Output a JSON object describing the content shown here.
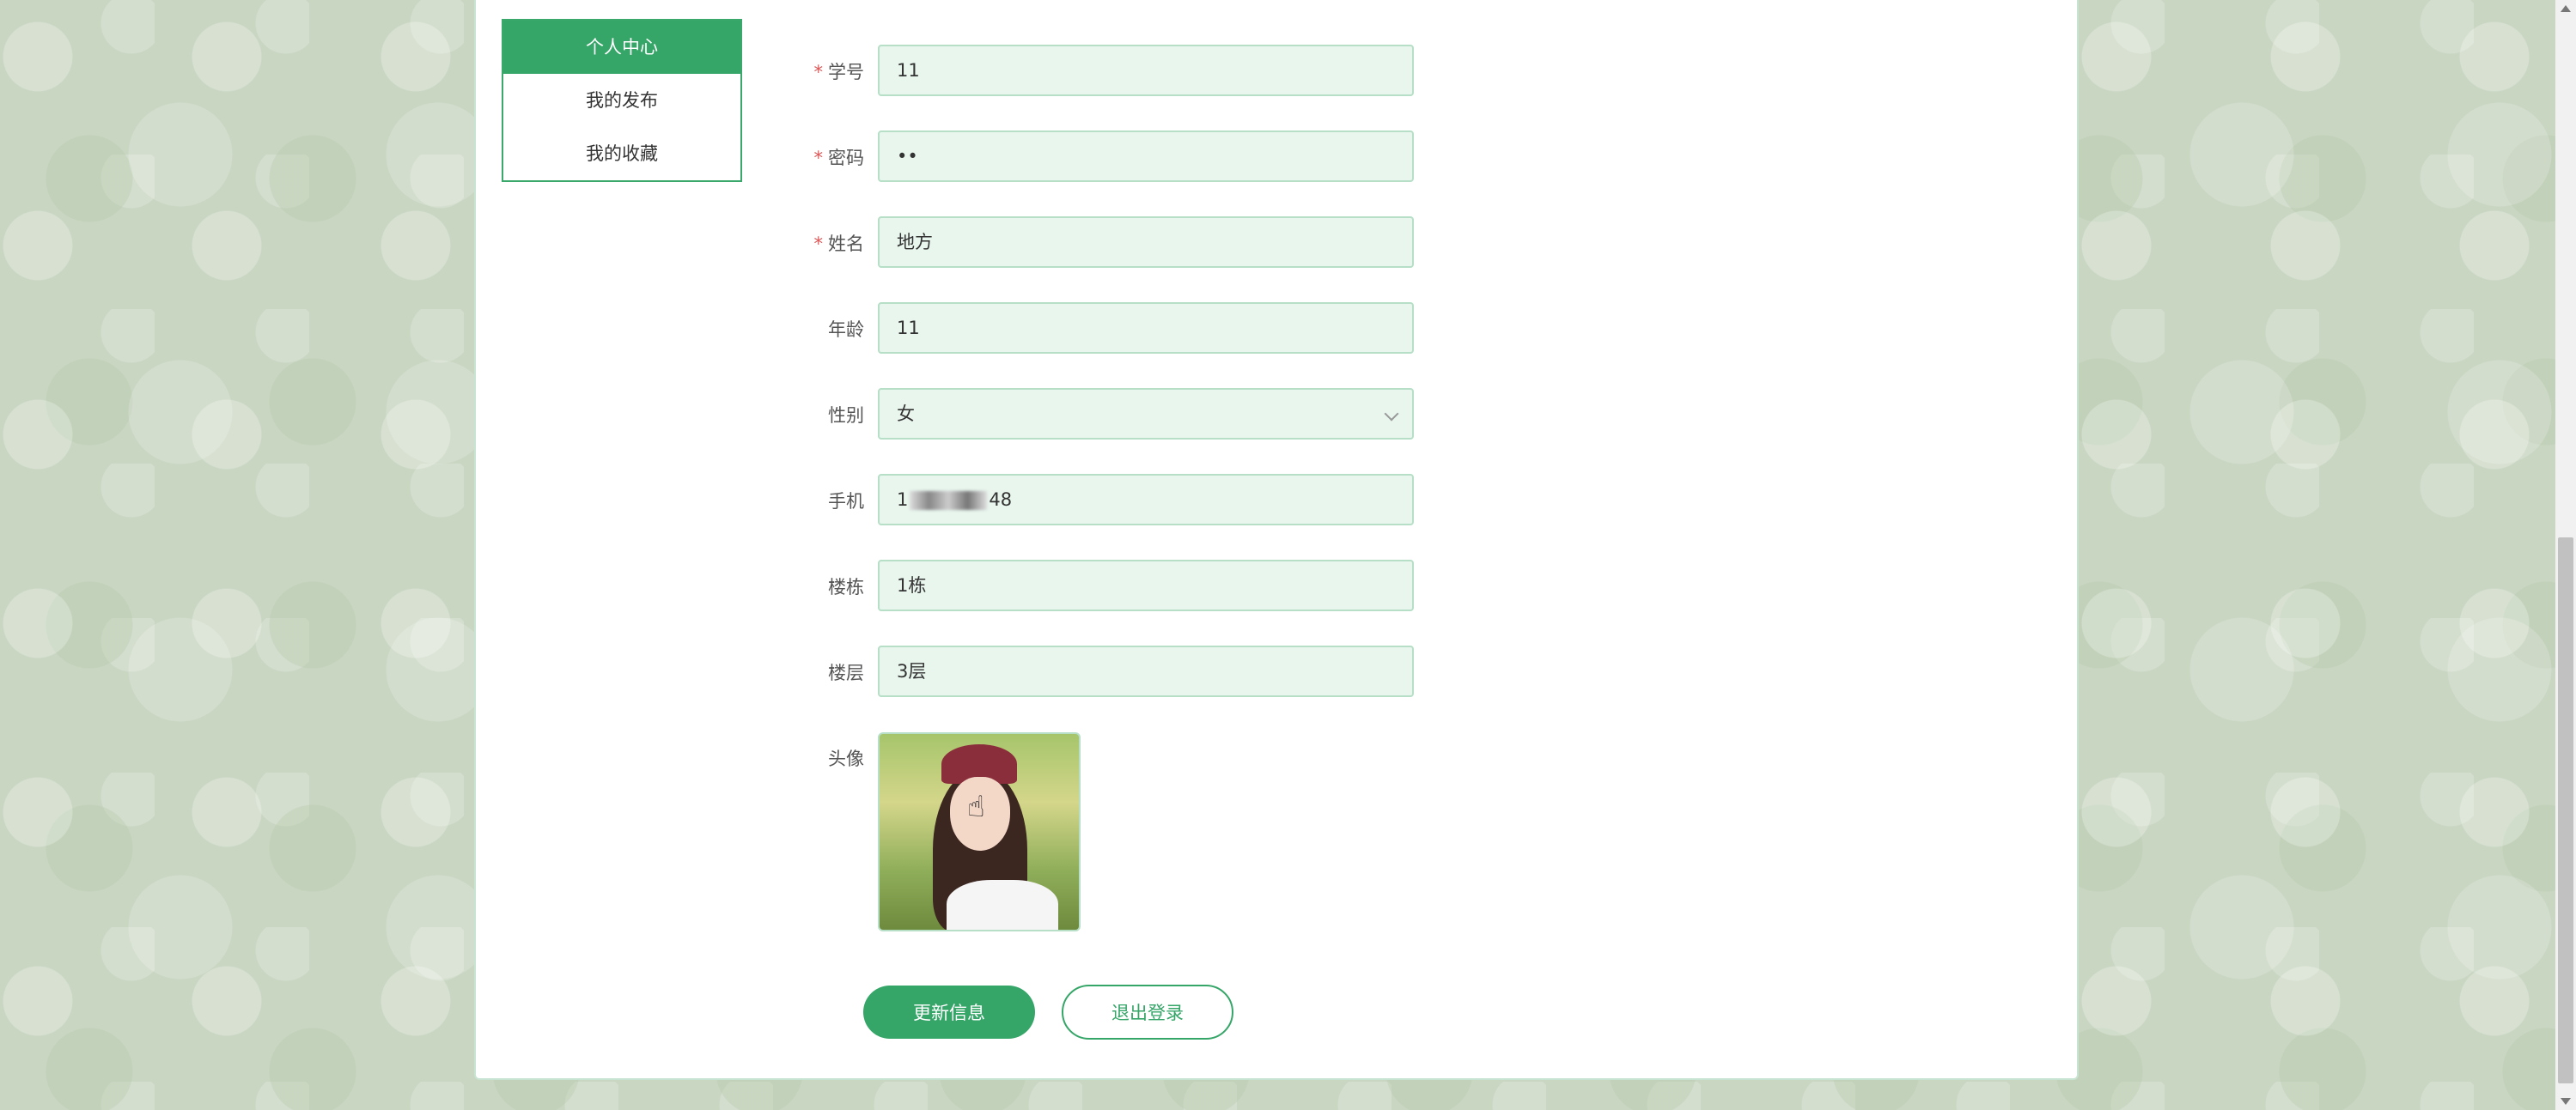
{
  "side_menu": {
    "items": [
      {
        "label": "个人中心",
        "active": true
      },
      {
        "label": "我的发布",
        "active": false
      },
      {
        "label": "我的收藏",
        "active": false
      }
    ]
  },
  "form": {
    "student_id": {
      "label": "学号",
      "required": true,
      "value": "11"
    },
    "password": {
      "label": "密码",
      "required": true,
      "value": "••"
    },
    "name": {
      "label": "姓名",
      "required": true,
      "value": "地方"
    },
    "age": {
      "label": "年龄",
      "required": false,
      "value": "11"
    },
    "gender": {
      "label": "性别",
      "required": false,
      "value": "女"
    },
    "phone": {
      "label": "手机",
      "required": false,
      "value_prefix": "1",
      "value_suffix": "48"
    },
    "building": {
      "label": "楼栋",
      "required": false,
      "value": "1栋"
    },
    "floor": {
      "label": "楼层",
      "required": false,
      "value": "3层"
    },
    "avatar": {
      "label": "头像"
    }
  },
  "buttons": {
    "update": "更新信息",
    "logout": "退出登录"
  },
  "icons": {
    "cursor": "hand-pointer-icon",
    "select": "chevron-down-icon"
  },
  "colors": {
    "accent": "#35a568",
    "input_bg": "#e8f6ee",
    "input_border": "#b7dfc7",
    "required": "#e05555"
  }
}
